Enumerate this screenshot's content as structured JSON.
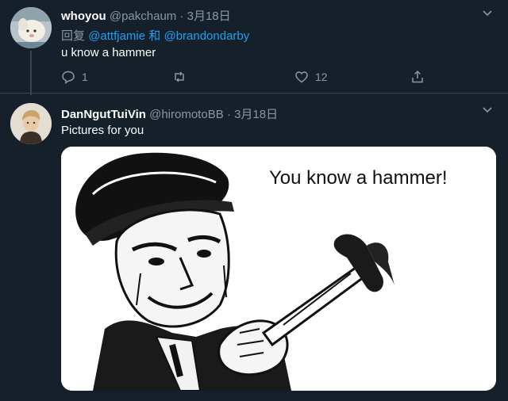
{
  "tweet1": {
    "display_name": "whoyou",
    "handle": "@pakchaum",
    "separator": "·",
    "date": "3月18日",
    "reply_prefix": "回复",
    "mention1": "@attfjamie",
    "reply_join": "和",
    "mention2": "@brandondarby",
    "text": "u know a hammer",
    "reply_count": "1",
    "like_count": "12",
    "icons": [
      "reply-icon",
      "retweet-icon",
      "like-icon",
      "share-icon",
      "chevron-down-icon"
    ]
  },
  "tweet2": {
    "display_name": "DanNgutTuiVin",
    "handle": "@hiromotoBB",
    "separator": "·",
    "date": "3月18日",
    "text": "Pictures for you",
    "image_caption": "You know a hammer!"
  },
  "colors": {
    "background": "#15202b",
    "secondary_text": "#8899a6",
    "link": "#1da1f2",
    "divider": "#38444d"
  }
}
